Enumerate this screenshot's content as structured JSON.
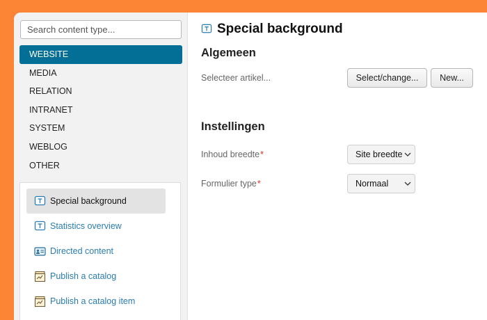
{
  "search": {
    "placeholder": "Search content type..."
  },
  "categories": [
    {
      "label": "WEBSITE"
    },
    {
      "label": "MEDIA"
    },
    {
      "label": "RELATION"
    },
    {
      "label": "INTRANET"
    },
    {
      "label": "SYSTEM"
    },
    {
      "label": "WEBLOG"
    },
    {
      "label": "OTHER"
    }
  ],
  "active_category": "WEBSITE",
  "content_types": [
    {
      "label": "Special background",
      "icon": "text-box-icon"
    },
    {
      "label": "Statistics overview",
      "icon": "text-box-icon"
    },
    {
      "label": "Directed content",
      "icon": "contact-card-icon"
    },
    {
      "label": "Publish a catalog",
      "icon": "catalog-icon"
    },
    {
      "label": "Publish a catalog item",
      "icon": "catalog-icon"
    }
  ],
  "selected_content_type": "Special background",
  "main": {
    "title": "Special background",
    "title_icon": "text-box-icon",
    "section_general": "Algemeen",
    "select_article_label": "Selecteer artikel...",
    "select_change_button": "Select/change...",
    "new_button": "New...",
    "section_settings": "Instellingen",
    "content_width_label": "Inhoud breedte",
    "content_width_value": "Site breedte",
    "form_type_label": "Formulier type",
    "form_type_value": "Normaal",
    "required_mark": "*"
  },
  "colors": {
    "background": "#fb8534",
    "active_category": "#036f97",
    "link": "#2a7cb1",
    "required": "#d9302a"
  }
}
